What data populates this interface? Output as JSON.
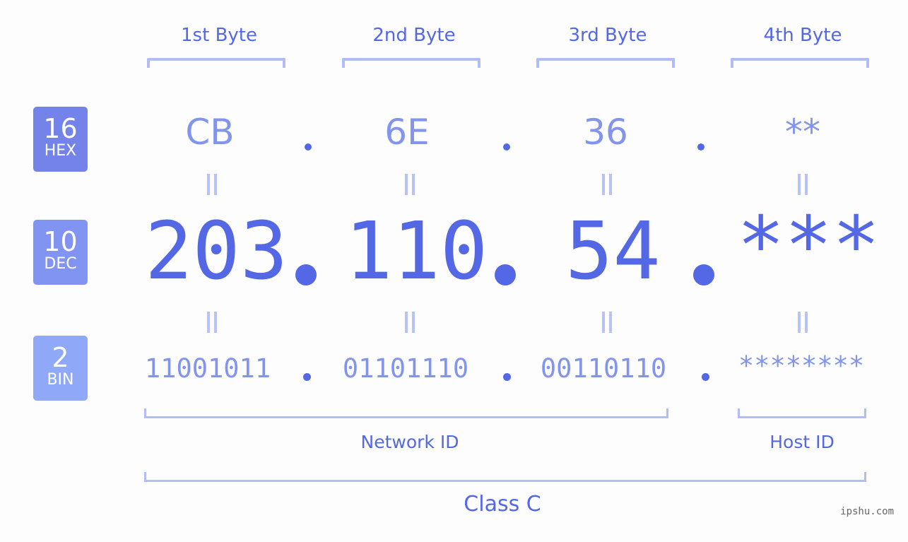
{
  "byte_headers": [
    "1st Byte",
    "2nd Byte",
    "3rd Byte",
    "4th Byte"
  ],
  "badges": {
    "hex": {
      "number": "16",
      "label": "HEX",
      "color": "#7483ea"
    },
    "dec": {
      "number": "10",
      "label": "DEC",
      "color": "#8294f2"
    },
    "bin": {
      "number": "2",
      "label": "BIN",
      "color": "#8fa8f8"
    }
  },
  "hex": [
    "CB",
    "6E",
    "36",
    "**"
  ],
  "dec": [
    "203",
    "110",
    "54",
    "***"
  ],
  "bin": [
    "11001011",
    "01101110",
    "00110110",
    "********"
  ],
  "separator": ".",
  "sections": {
    "network_id": "Network ID",
    "host_id": "Host ID",
    "class": "Class C"
  },
  "watermark": "ipshu.com",
  "colors": {
    "accent": "#5468e6",
    "light_value": "#8294ec",
    "bracket": "#b2bcf6",
    "background": "#fcfdfc"
  }
}
